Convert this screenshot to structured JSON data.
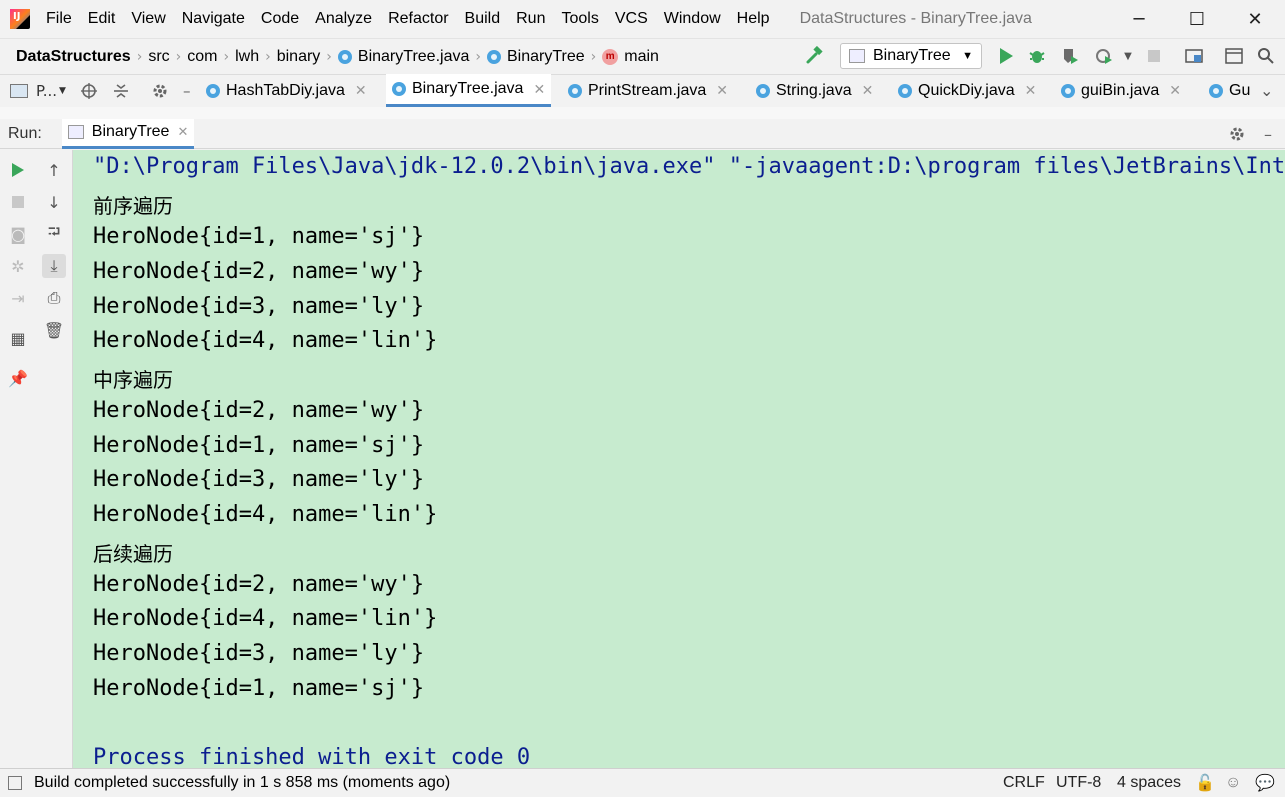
{
  "menubar": {
    "logo_text": "IJ",
    "items": [
      "File",
      "Edit",
      "View",
      "Navigate",
      "Code",
      "Analyze",
      "Refactor",
      "Build",
      "Run",
      "Tools",
      "VCS",
      "Window",
      "Help"
    ],
    "title": "DataStructures - BinaryTree.java",
    "controls": {
      "minimize": "─",
      "maximize": "☐",
      "close": "✕"
    }
  },
  "navbar": {
    "breadcrumbs": [
      "DataStructures",
      "src",
      "com",
      "lwh",
      "binary",
      "BinaryTree.java",
      "BinaryTree",
      "main"
    ],
    "run_config": "BinaryTree"
  },
  "tabbar": {
    "project_tool": "P...",
    "tabs": [
      {
        "label": "HashTabDiy.java"
      },
      {
        "label": "BinaryTree.java"
      },
      {
        "label": "PrintStream.java"
      },
      {
        "label": "String.java"
      },
      {
        "label": "QuickDiy.java"
      },
      {
        "label": "guiBin.java"
      },
      {
        "label": "Gu"
      }
    ],
    "active_tab": "BinaryTree.java"
  },
  "run_panel": {
    "label": "Run:",
    "tab": "BinaryTree"
  },
  "console": {
    "command": "\"D:\\Program Files\\Java\\jdk-12.0.2\\bin\\java.exe\" \"-javaagent:D:\\program files\\JetBrains\\Intel",
    "lines": [
      "前序遍历",
      "HeroNode{id=1, name='sj'}",
      "HeroNode{id=2, name='wy'}",
      "HeroNode{id=3, name='ly'}",
      "HeroNode{id=4, name='lin'}",
      "中序遍历",
      "HeroNode{id=2, name='wy'}",
      "HeroNode{id=1, name='sj'}",
      "HeroNode{id=3, name='ly'}",
      "HeroNode{id=4, name='lin'}",
      "后续遍历",
      "HeroNode{id=2, name='wy'}",
      "HeroNode{id=4, name='lin'}",
      "HeroNode{id=3, name='ly'}",
      "HeroNode{id=1, name='sj'}"
    ],
    "exit_message": "Process finished with exit code 0"
  },
  "statusbar": {
    "message": "Build completed successfully in 1 s 858 ms (moments ago)",
    "line_sep": "CRLF",
    "encoding": "UTF-8",
    "indent": "4 spaces"
  },
  "colors": {
    "console_bg": "#c7ebcf",
    "command_text": "#0b1e8f",
    "run_green": "#3aa65a",
    "tab_underline": "#4a88c7"
  }
}
